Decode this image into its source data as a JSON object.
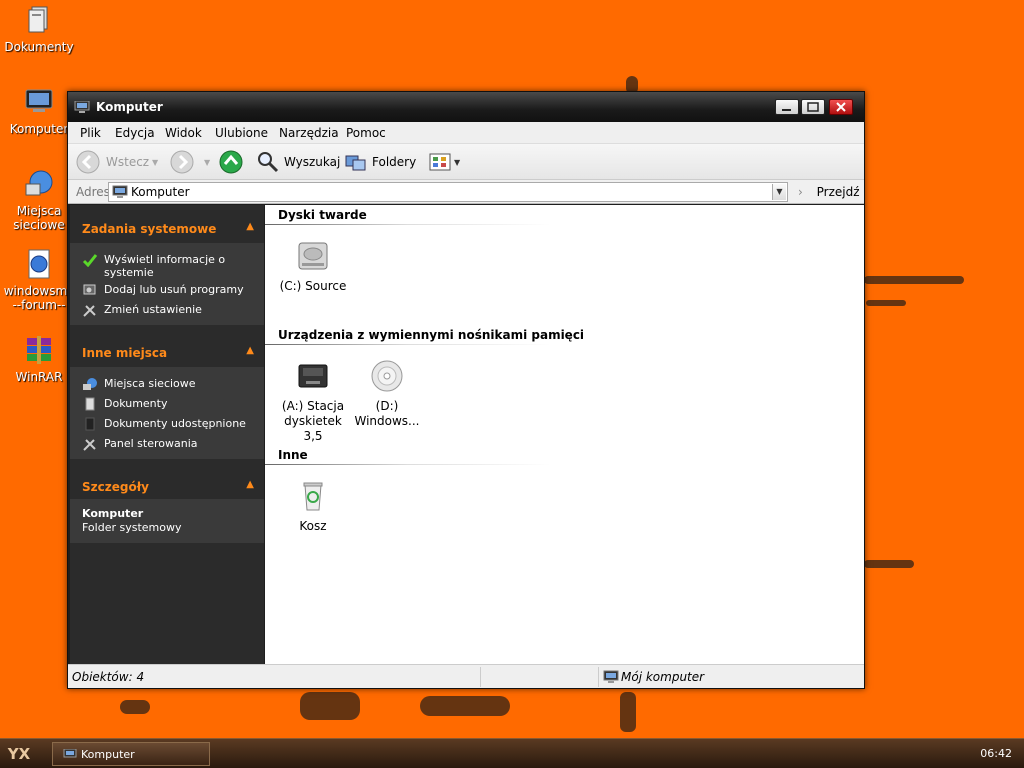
{
  "desktop": {
    "icons": [
      {
        "label": "Dokumenty",
        "icon": "documents-icon"
      },
      {
        "label": "Komputer",
        "icon": "computer-icon"
      },
      {
        "label": "Miejsca sieciowe",
        "icon": "network-places-icon"
      },
      {
        "label": "windowsmx --forum--",
        "icon": "internet-shortcut-icon"
      },
      {
        "label": "WinRAR",
        "icon": "winrar-icon"
      }
    ]
  },
  "window": {
    "title": "Komputer",
    "menu": [
      "Plik",
      "Edycja",
      "Widok",
      "Ulubione",
      "Narzędzia",
      "Pomoc"
    ],
    "toolbar": {
      "back": "Wstecz",
      "search": "Wyszukaj",
      "folders": "Foldery"
    },
    "address": {
      "label": "Adres",
      "value": "Komputer",
      "go": "Przejdź"
    },
    "taskpane": {
      "sections": [
        {
          "title": "Zadania systemowe",
          "links": [
            {
              "label": "Wyświetl informacje o systemie",
              "icon": "checkmark-icon"
            },
            {
              "label": "Dodaj lub usuń programy",
              "icon": "install-icon"
            },
            {
              "label": "Zmień ustawienie",
              "icon": "tools-icon"
            }
          ]
        },
        {
          "title": "Inne miejsca",
          "links": [
            {
              "label": "Miejsca sieciowe",
              "icon": "network-places-icon"
            },
            {
              "label": "Dokumenty",
              "icon": "documents-icon"
            },
            {
              "label": "Dokumenty udostępnione",
              "icon": "shared-folder-icon"
            },
            {
              "label": "Panel sterowania",
              "icon": "control-panel-icon"
            }
          ]
        },
        {
          "title": "Szczegóły",
          "detail_name": "Komputer",
          "detail_desc": "Folder systemowy"
        }
      ]
    },
    "groups": [
      {
        "title": "Dyski twarde",
        "items": [
          {
            "label": "(C:) Source",
            "icon": "hard-drive-icon"
          }
        ]
      },
      {
        "title": "Urządzenia z wymiennymi nośnikami pamięci",
        "items": [
          {
            "label": "(A:) Stacja dyskietek 3,5",
            "icon": "floppy-drive-icon"
          },
          {
            "label": "(D:) Windows...",
            "icon": "cd-drive-icon"
          }
        ]
      },
      {
        "title": "Inne",
        "items": [
          {
            "label": "Kosz",
            "icon": "recycle-bin-icon"
          }
        ]
      }
    ],
    "status": {
      "objects": "Obiektów: 4",
      "location": "Mój komputer"
    }
  },
  "taskbar": {
    "start": "YX",
    "task": "Komputer",
    "clock": "06:42"
  },
  "colors": {
    "desktop": "#ff6a00",
    "pane_accent": "#ff8a1a",
    "pane_bg": "#2b2b2b"
  }
}
